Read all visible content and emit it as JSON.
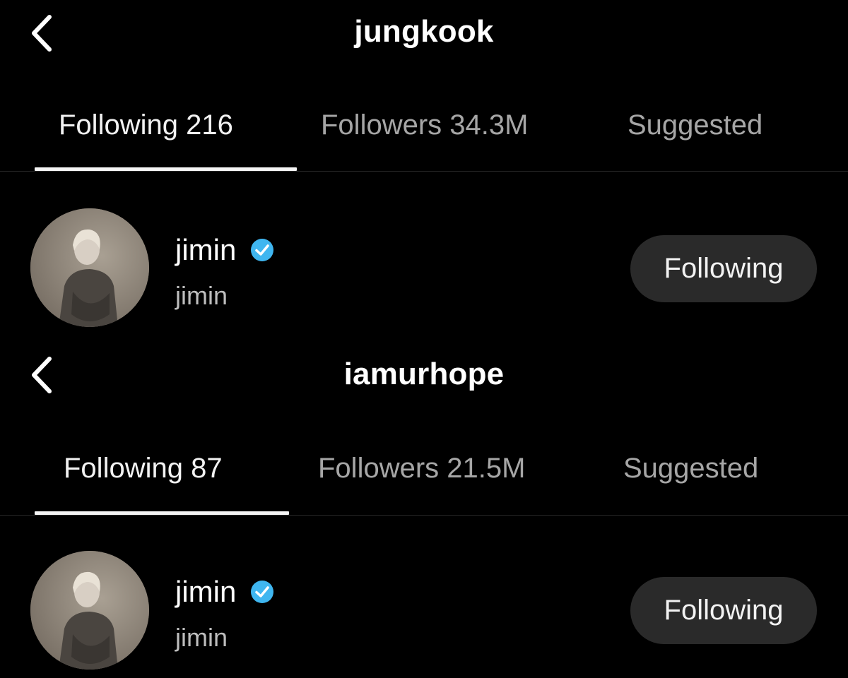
{
  "colors": {
    "background": "#000000",
    "active_text": "#f2f2f2",
    "inactive_text": "#a6a6a6",
    "button_bg": "#2a2a2a",
    "verified": "#3fb6f0"
  },
  "panels": [
    {
      "title": "jungkook",
      "back_icon": "chevron-left-icon",
      "tabs": [
        {
          "label": "Following 216",
          "active": true
        },
        {
          "label": "Followers 34.3M",
          "active": false
        },
        {
          "label": "Suggested",
          "active": false
        }
      ],
      "user": {
        "username": "jimin",
        "display_name": "jimin",
        "verified": true,
        "button_label": "Following"
      }
    },
    {
      "title": "iamurhope",
      "back_icon": "chevron-left-icon",
      "tabs": [
        {
          "label": "Following 87",
          "active": true
        },
        {
          "label": "Followers 21.5M",
          "active": false
        },
        {
          "label": "Suggested",
          "active": false
        }
      ],
      "user": {
        "username": "jimin",
        "display_name": "jimin",
        "verified": true,
        "button_label": "Following"
      }
    }
  ]
}
